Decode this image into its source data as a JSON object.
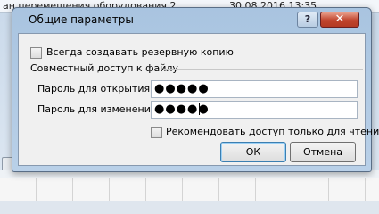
{
  "background": {
    "file_name": "ан перемещения оборудования 2...",
    "file_date": "30.08.2016 13:35"
  },
  "dialog": {
    "title": "Общие параметры",
    "help_label": "?",
    "close_label": "✕",
    "backup_label": "Всегда создавать резервную копию",
    "group_label": "Совместный доступ к файлу",
    "open_password_label": "Пароль для открытия:",
    "open_password_value": "●●●●●",
    "modify_password_label": "Пароль для изменения:",
    "modify_password_value": "●●●●●",
    "readonly_label": "Рекомендовать доступ только для чтения",
    "ok_label": "ОК",
    "cancel_label": "Отмена"
  }
}
